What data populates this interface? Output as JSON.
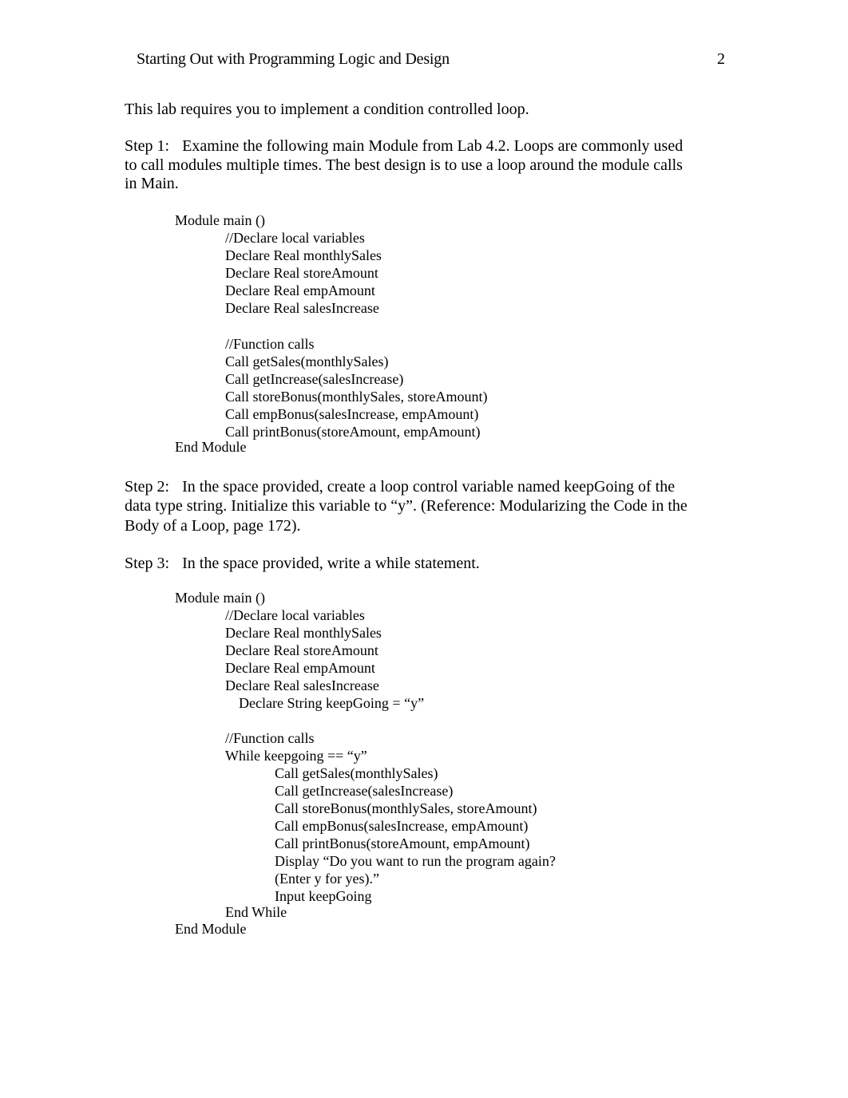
{
  "header": {
    "title": "Starting Out with Programming Logic and Design",
    "page_number": "2"
  },
  "intro": "This lab requires you to implement a condition controlled loop.",
  "step1": {
    "label": "Step 1:",
    "lines": [
      "Examine the following main Module from Lab 4.2.  Loops are commonly used",
      "to call modules multiple times.  The best design is to use a loop around the module calls",
      "in Main."
    ]
  },
  "code1": {
    "module_start": "Module main ()",
    "declare_comment": "//Declare local variables",
    "declarations": [
      "Declare Real monthlySales",
      "Declare Real storeAmount",
      "Declare Real empAmount",
      "Declare Real salesIncrease"
    ],
    "calls_comment": "//Function calls",
    "calls": [
      "Call getSales(monthlySales)",
      "Call getIncrease(salesIncrease)",
      "Call storeBonus(monthlySales, storeAmount)",
      "Call empBonus(salesIncrease, empAmount)",
      "Call printBonus(storeAmount, empAmount)"
    ],
    "module_end": "End Module"
  },
  "step2": {
    "label": "Step 2:",
    "lines": [
      "In the space provided, create a loop control variable named keepGoing of the",
      "data type string.  Initialize this variable to “y”.  (Reference: Modularizing the Code in the",
      "Body of a Loop, page 172)."
    ]
  },
  "step3": {
    "label": "Step 3:",
    "text": "In the space provided, write a while statement."
  },
  "code2": {
    "module_start": "Module main ()",
    "declare_comment": "//Declare local variables",
    "declarations": [
      "Declare Real monthlySales",
      "Declare Real storeAmount",
      "Declare Real empAmount",
      "Declare Real salesIncrease"
    ],
    "keepgoing_declaration": "Declare String keepGoing = “y”",
    "calls_comment": "//Function calls",
    "while_start": "While keepgoing == “y”",
    "loop_body": [
      "Call getSales(monthlySales)",
      "Call getIncrease(salesIncrease)",
      "Call storeBonus(monthlySales, storeAmount)",
      "Call empBonus(salesIncrease, empAmount)",
      "Call printBonus(storeAmount, empAmount)",
      "Display “Do you want to run the program again?",
      "(Enter y for yes).”",
      "Input keepGoing"
    ],
    "while_end": "End While",
    "module_end": "End Module"
  }
}
